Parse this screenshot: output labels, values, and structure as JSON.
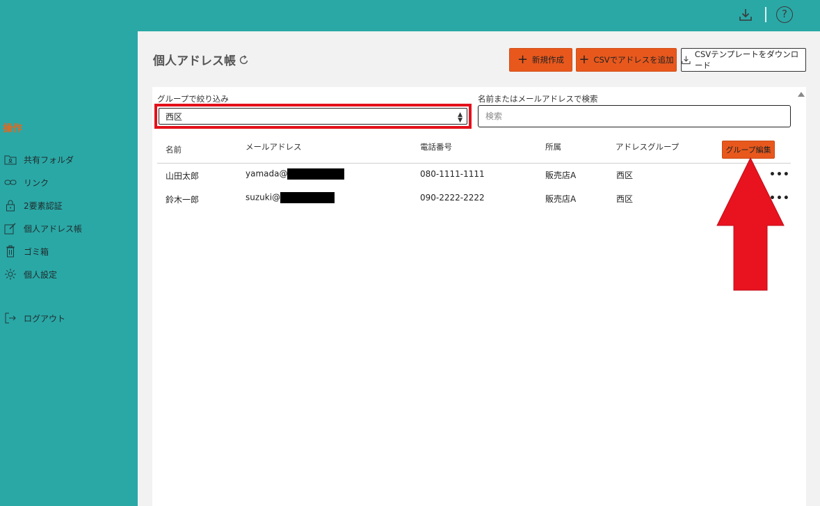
{
  "topbar": {
    "download_icon": "download-icon",
    "help_icon": "help-icon",
    "help_glyph": "?"
  },
  "sidebar": {
    "heading": "操作",
    "items": [
      {
        "label": "共有フォルダ",
        "icon": "shared-folder-icon"
      },
      {
        "label": "リンク",
        "icon": "link-icon"
      },
      {
        "label": "2要素認証",
        "icon": "lock-icon"
      },
      {
        "label": "個人アドレス帳",
        "icon": "edit-icon"
      },
      {
        "label": "ゴミ箱",
        "icon": "trash-icon"
      },
      {
        "label": "個人設定",
        "icon": "gear-icon"
      },
      {
        "label": "ログアウト",
        "icon": "logout-icon"
      }
    ]
  },
  "main": {
    "title": "個人アドレス帳",
    "buttons": {
      "new": "新規作成",
      "csv_add": "CSVでアドレスを追加",
      "csv_template": "CSVテンプレートをダウンロード"
    },
    "filter": {
      "group_label": "グループで絞り込み",
      "group_value": "西区",
      "search_label": "名前またはメールアドレスで検索",
      "search_placeholder": "検索"
    },
    "table": {
      "headers": [
        "名前",
        "メールアドレス",
        "電話番号",
        "所属",
        "アドレスグループ"
      ],
      "group_edit_label": "グループ編集",
      "rows": [
        {
          "name": "山田太郎",
          "email": "yamada@",
          "phone": "080-1111-1111",
          "affiliation": "販売店A",
          "group": "西区"
        },
        {
          "name": "鈴木一郎",
          "email": "suzuki@",
          "phone": "090-2222-2222",
          "affiliation": "販売店A",
          "group": "西区"
        }
      ],
      "more_glyph": "•••"
    }
  },
  "colors": {
    "teal": "#2aa8a6",
    "accent": "#e8581d",
    "highlight": "#e3111b"
  }
}
